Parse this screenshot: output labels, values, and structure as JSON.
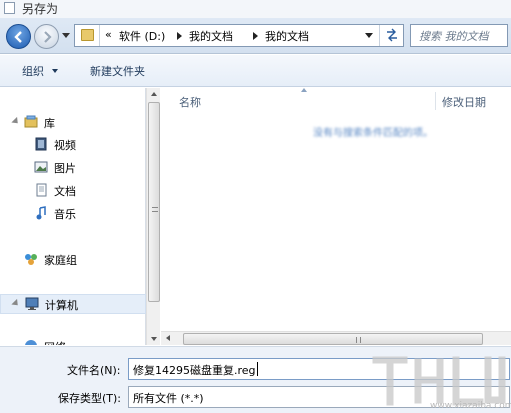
{
  "window": {
    "title": "另存为"
  },
  "nav": {
    "breadcrumb": {
      "overflow": "«",
      "items": [
        "软件 (D:)",
        "我的文档",
        "我的文档"
      ]
    },
    "search_placeholder": "搜索 我的文档"
  },
  "toolbar": {
    "organize": "组织",
    "new_folder": "新建文件夹"
  },
  "sidebar": {
    "items": [
      {
        "label": "库",
        "icon": "library-icon"
      },
      {
        "label": "视频",
        "icon": "video-icon"
      },
      {
        "label": "图片",
        "icon": "pictures-icon"
      },
      {
        "label": "文档",
        "icon": "documents-icon"
      },
      {
        "label": "音乐",
        "icon": "music-icon"
      },
      {
        "label": "家庭组",
        "icon": "homegroup-icon"
      },
      {
        "label": "计算机",
        "icon": "computer-icon"
      },
      {
        "label": "网络",
        "icon": "network-icon"
      }
    ]
  },
  "content": {
    "columns": [
      "名称",
      "修改日期"
    ],
    "empty_message": "没有与搜索条件匹配的项。"
  },
  "form": {
    "filename_label": "文件名(N):",
    "filename_value": "修复14295磁盘重复.reg",
    "filetype_label": "保存类型(T):",
    "filetype_value": "所有文件  (*.*)"
  },
  "watermark": {
    "url": "www.xiazaiba.com"
  },
  "colors": {
    "accent": "#1c5bb0",
    "toolbar_text": "#1e395b",
    "selection": "#e5eef9"
  }
}
